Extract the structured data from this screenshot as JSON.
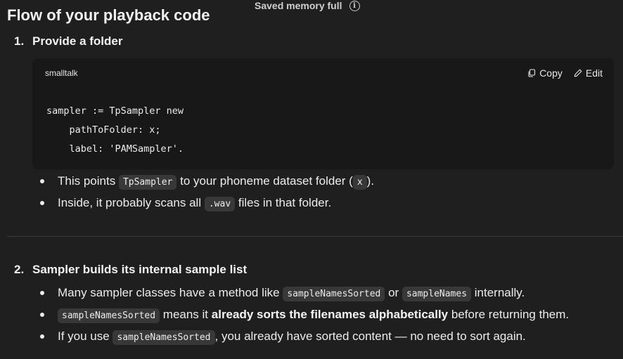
{
  "banner": {
    "text": "Saved memory full",
    "icon": "info-icon"
  },
  "title": "Flow of your playback code",
  "step1": {
    "number": "1.",
    "heading": "Provide a folder",
    "code": {
      "language": "smalltalk",
      "copy_label": "Copy",
      "edit_label": "Edit",
      "lines": [
        "sampler := TpSampler new",
        "    pathToFolder: x;",
        "    label: 'PAMSampler'."
      ]
    },
    "bullets": [
      {
        "t1": "This points ",
        "c1": "TpSampler",
        "t2": " to your phoneme dataset folder (",
        "c2": "x",
        "t3": ")."
      },
      {
        "t1": "Inside, it probably scans all ",
        "c1": ".wav",
        "t2": " files in that folder."
      }
    ]
  },
  "step2": {
    "number": "2.",
    "heading": "Sampler builds its internal sample list",
    "bullets": [
      {
        "t1": "Many sampler classes have a method like ",
        "c1": "sampleNamesSorted",
        "t2": " or ",
        "c2": "sampleNames",
        "t3": " internally."
      },
      {
        "c1": "sampleNamesSorted",
        "t1": " means it ",
        "b1": "already sorts the filenames alphabetically",
        "t2": " before returning them."
      },
      {
        "t1": "If you use ",
        "c1": "sampleNamesSorted",
        "t2": ", you already have sorted content — no need to sort again."
      }
    ]
  }
}
